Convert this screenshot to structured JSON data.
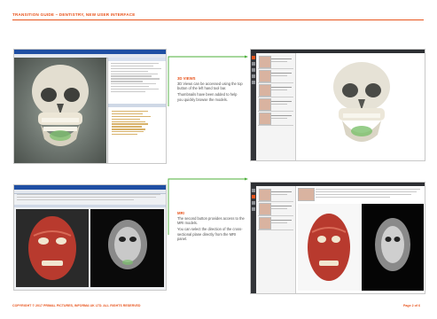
{
  "header": {
    "title": "TRANSITION GUIDE – DENTISTRY, NEW USER INTERFACE"
  },
  "footer": {
    "copyright": "COPYRIGHT © 2017 PRIMAL PICTURES, INFORMA UK LTD. ALL RIGHTS RESERVED",
    "page": "Page 2 of 6"
  },
  "section_3d": {
    "title": "3D VIEWS",
    "para1": "3D Views can be accessed using the top button of the left hand tool bar.",
    "para2": "Thumbnails have been added to help you quickly browse the models."
  },
  "section_mri": {
    "title": "MRI",
    "para1": "The second button provides access to the MRI models.",
    "para2": "You can select the direction of the cross-sectional plane directly from the MRI panel."
  },
  "colors": {
    "accent": "#e8541c",
    "connector": "#4caf3a",
    "legacy_titlebar": "#1f4fa3",
    "new_toolbar": "#2d2f33"
  }
}
